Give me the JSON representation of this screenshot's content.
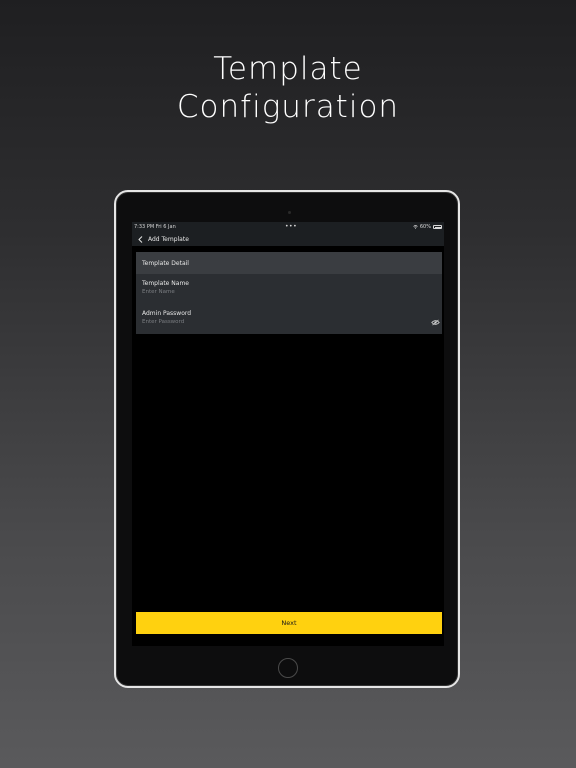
{
  "headline": {
    "line1": "Template",
    "line2": "Configuration"
  },
  "status_bar": {
    "time": "7:33 PM   Fri 6 Jan",
    "dots": "•••",
    "battery_percent": "60%",
    "icons": [
      "wifi-icon",
      "battery-icon"
    ]
  },
  "nav": {
    "back_icon": "chevron-left-icon",
    "title": "Add Template"
  },
  "form": {
    "section_title": "Template Detail",
    "fields": [
      {
        "label": "Template Name",
        "placeholder": "Enter Name"
      },
      {
        "label": "Admin Password",
        "placeholder": "Enter Password",
        "trailing_icon": "eye-off-icon"
      }
    ]
  },
  "next_button": {
    "label": "Next",
    "color": "#ffd10f"
  },
  "colors": {
    "accent": "#ffd10f",
    "card_bg": "#2b2e32",
    "card_header_bg": "#3a3d41"
  }
}
